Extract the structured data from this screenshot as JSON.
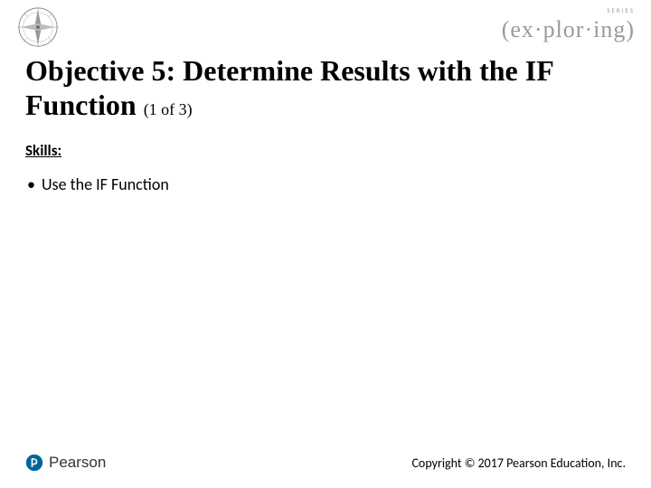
{
  "header": {
    "series_small": "SERIES",
    "series_main": "(ex·plor·ing)",
    "series_tag1": "",
    "series_tag2": ""
  },
  "title_line1": "Objective 5: Determine Results with the IF",
  "title_line2": "Function",
  "title_progress": "(1 of 3)",
  "skills_label": "Skills:",
  "bullets": [
    "Use the IF Function"
  ],
  "footer": {
    "publisher": "Pearson",
    "copyright": "Copyright © 2017 Pearson Education, Inc."
  }
}
